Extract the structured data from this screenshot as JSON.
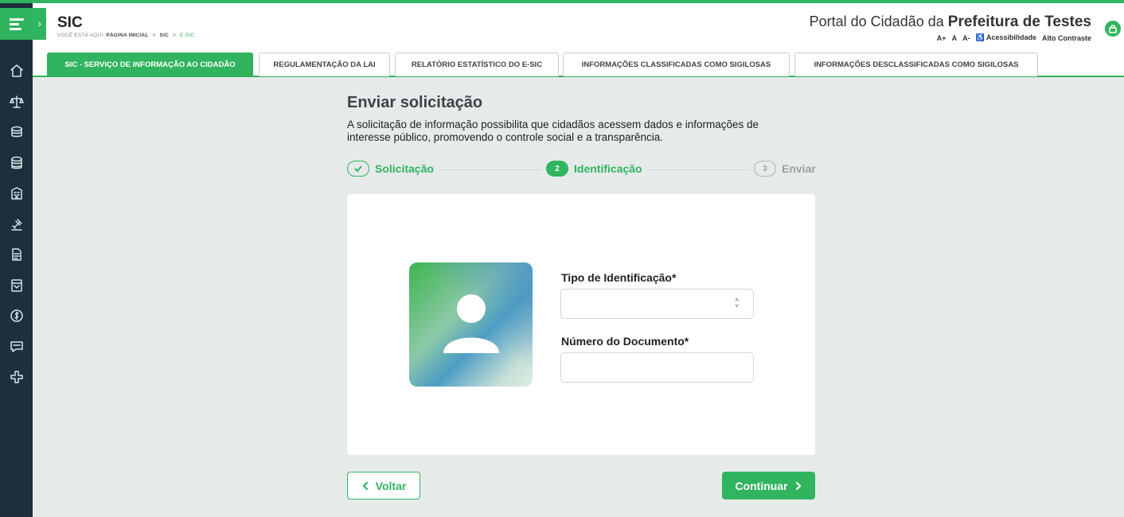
{
  "header": {
    "app_title": "SIC",
    "breadcrumb": {
      "prefix": "VOCÊ ESTÁ AQUI:",
      "items": [
        "PÁGINA INICIAL",
        "SIC",
        "E-SIC"
      ],
      "separator": ">"
    },
    "portal_title_prefix": "Portal do Cidadão da",
    "portal_title_bold": "Prefeitura de Testes",
    "accessibility": {
      "font_increase": "A+",
      "font_normal": "A",
      "font_decrease": "A-",
      "accessibility_label": "Acessibilidade",
      "high_contrast": "Alto Contraste"
    }
  },
  "sidebar": {
    "icons": [
      "home-icon",
      "scales-icon",
      "coins-icon",
      "coins-stack-icon",
      "building-icon",
      "gavel-icon",
      "document-icon",
      "spreadsheet-icon",
      "money-icon",
      "chat-icon",
      "plus-cross-icon"
    ]
  },
  "tabs": [
    {
      "label": "SIC - SERVIÇO DE INFORMAÇÃO AO CIDADÃO",
      "active": true
    },
    {
      "label": "REGULAMENTAÇÃO DA LAI",
      "active": false
    },
    {
      "label": "RELATÓRIO ESTATÍSTICO DO E-SIC",
      "active": false
    },
    {
      "label": "INFORMAÇÕES CLASSIFICADAS COMO SIGILOSAS",
      "active": false
    },
    {
      "label": "INFORMAÇÕES DESCLASSIFICADAS COMO SIGILOSAS",
      "active": false
    }
  ],
  "main": {
    "title": "Enviar solicitação",
    "description": "A solicitação de informação possibilita que cidadãos acessem dados e informações de interesse público, promovendo o controle social e a transparência.",
    "steps": [
      {
        "label": "Solicitação",
        "status": "done"
      },
      {
        "number": "2",
        "label": "Identificação",
        "status": "active"
      },
      {
        "number": "3",
        "label": "Enviar",
        "status": "pending"
      }
    ],
    "form": {
      "id_type_label": "Tipo de Identificação*",
      "id_type_value": "",
      "doc_number_label": "Número do Documento*",
      "doc_number_value": ""
    },
    "back_label": "Voltar",
    "continue_label": "Continuar"
  },
  "colors": {
    "brand_green": "#31b45f",
    "sidebar_bg": "#1d2f3c",
    "page_bg": "#e6ebea"
  }
}
